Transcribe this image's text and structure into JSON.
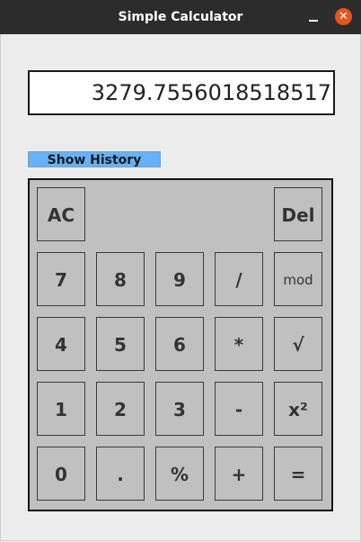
{
  "window": {
    "title": "Simple Calculator",
    "close_glyph": "✕"
  },
  "display": {
    "value": "3279.7556018518517"
  },
  "history_button": {
    "label": "Show History"
  },
  "keys": {
    "ac": "AC",
    "del": "Del",
    "seven": "7",
    "eight": "8",
    "nine": "9",
    "divide": "/",
    "mod": "mod",
    "four": "4",
    "five": "5",
    "six": "6",
    "multiply": "*",
    "sqrt": "√",
    "one": "1",
    "two": "2",
    "three": "3",
    "minus": "-",
    "square": "x²",
    "zero": "0",
    "dot": ".",
    "percent": "%",
    "plus": "+",
    "equals": "="
  },
  "colors": {
    "titlebar": "#2c2c2c",
    "close_button": "#e95420",
    "history_button": "#64b2f8",
    "keypad": "#c0c0c0"
  }
}
